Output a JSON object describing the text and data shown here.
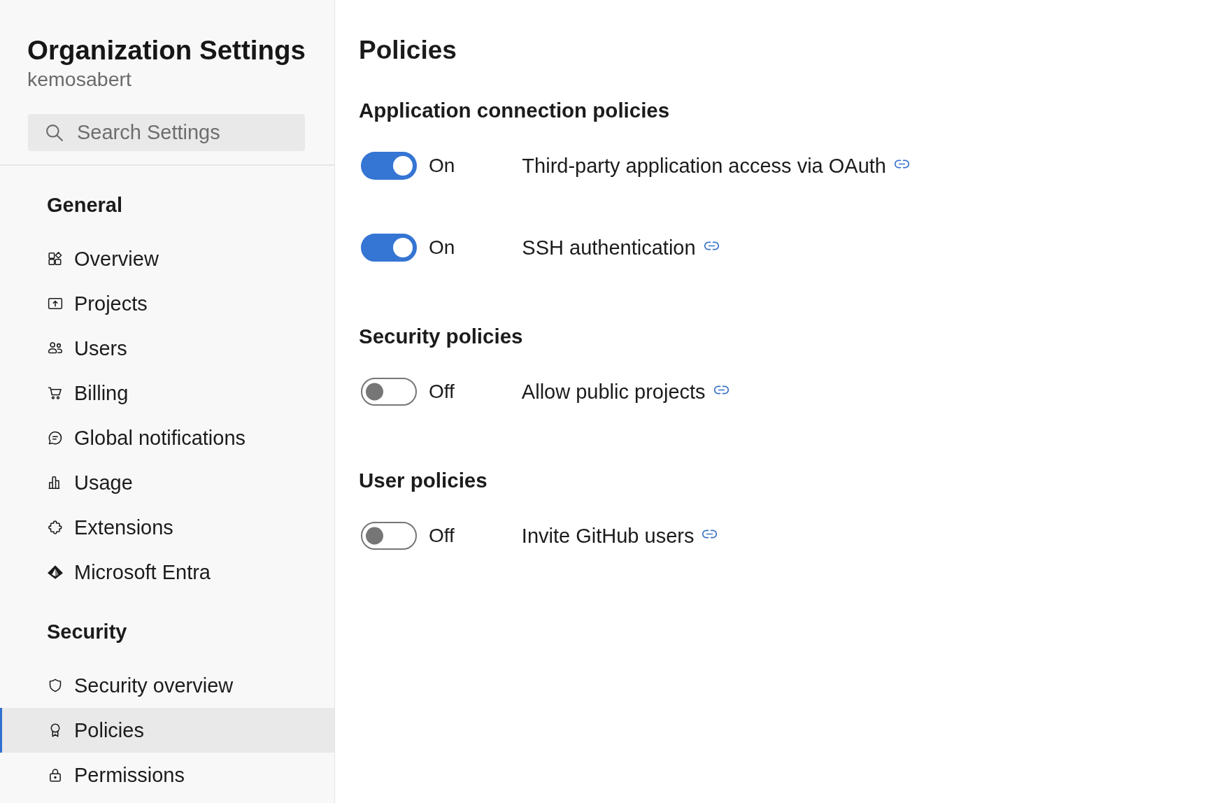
{
  "sidebar": {
    "title": "Organization Settings",
    "subtitle": "kemosabert",
    "search": {
      "placeholder": "Search Settings"
    },
    "sections": [
      {
        "heading": "General",
        "items": [
          {
            "label": "Overview",
            "selected": false
          },
          {
            "label": "Projects",
            "selected": false
          },
          {
            "label": "Users",
            "selected": false
          },
          {
            "label": "Billing",
            "selected": false
          },
          {
            "label": "Global notifications",
            "selected": false
          },
          {
            "label": "Usage",
            "selected": false
          },
          {
            "label": "Extensions",
            "selected": false
          },
          {
            "label": "Microsoft Entra",
            "selected": false
          }
        ]
      },
      {
        "heading": "Security",
        "items": [
          {
            "label": "Security overview",
            "selected": false
          },
          {
            "label": "Policies",
            "selected": true
          },
          {
            "label": "Permissions",
            "selected": false
          }
        ]
      }
    ]
  },
  "main": {
    "title": "Policies",
    "groups": [
      {
        "heading": "Application connection policies",
        "policies": [
          {
            "on": true,
            "state_label": "On",
            "label": "Third-party application access via OAuth"
          },
          {
            "on": true,
            "state_label": "On",
            "label": "SSH authentication"
          }
        ]
      },
      {
        "heading": "Security policies",
        "policies": [
          {
            "on": false,
            "state_label": "Off",
            "label": "Allow public projects"
          }
        ]
      },
      {
        "heading": "User policies",
        "policies": [
          {
            "on": false,
            "state_label": "Off",
            "label": "Invite GitHub users"
          }
        ]
      }
    ]
  }
}
